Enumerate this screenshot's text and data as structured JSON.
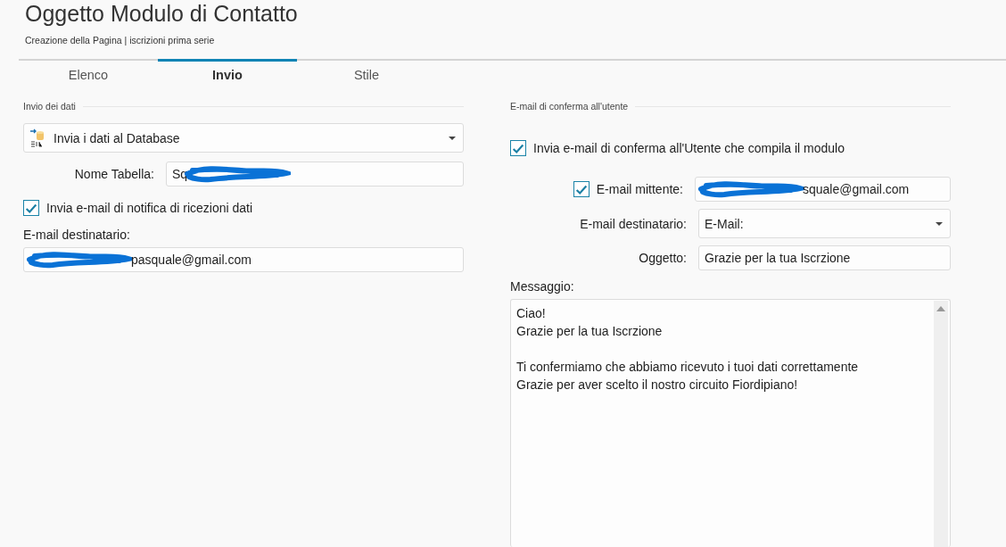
{
  "header": {
    "title": "Oggetto Modulo di Contatto",
    "subtitle": "Creazione della Pagina | iscrizioni prima serie"
  },
  "tabs": [
    {
      "label": "Elenco",
      "selected": false
    },
    {
      "label": "Invio",
      "selected": true
    },
    {
      "label": "Stile",
      "selected": false
    }
  ],
  "data_submission": {
    "heading": "Invio dei dati",
    "action_dropdown": {
      "value": "Invia i dati al Database"
    },
    "table_name": {
      "label": "Nome Tabella:",
      "value": "Sq",
      "scribble_after": true
    },
    "notify_checkbox": {
      "label": "Invia e-mail di notifica di ricezioni dati",
      "checked": true
    },
    "recipient": {
      "label": "E-mail destinatario:",
      "value": "pasquale@gmail.com",
      "scribble_before": true
    }
  },
  "confirmation": {
    "heading": "E-mail di conferma all'utente",
    "send_checkbox": {
      "label": "Invia e-mail di conferma all'Utente che compila il modulo",
      "checked": true
    },
    "sender": {
      "label": "E-mail mittente:",
      "checked": true,
      "value": "squale@gmail.com",
      "scribble_before": true
    },
    "recipient": {
      "label": "E-mail destinatario:",
      "value": "E-Mail:"
    },
    "subject": {
      "label": "Oggetto:",
      "value": "Grazie per la tua Iscrzione"
    },
    "message": {
      "label": "Messaggio:",
      "value": "Ciao!\nGrazie per la tua Iscrzione\n\nTi confermiamo che abbiamo ricevuto i tuoi dati correttamente\nGrazie per aver scelto il nostro circuito Fiordipiano!"
    }
  }
}
